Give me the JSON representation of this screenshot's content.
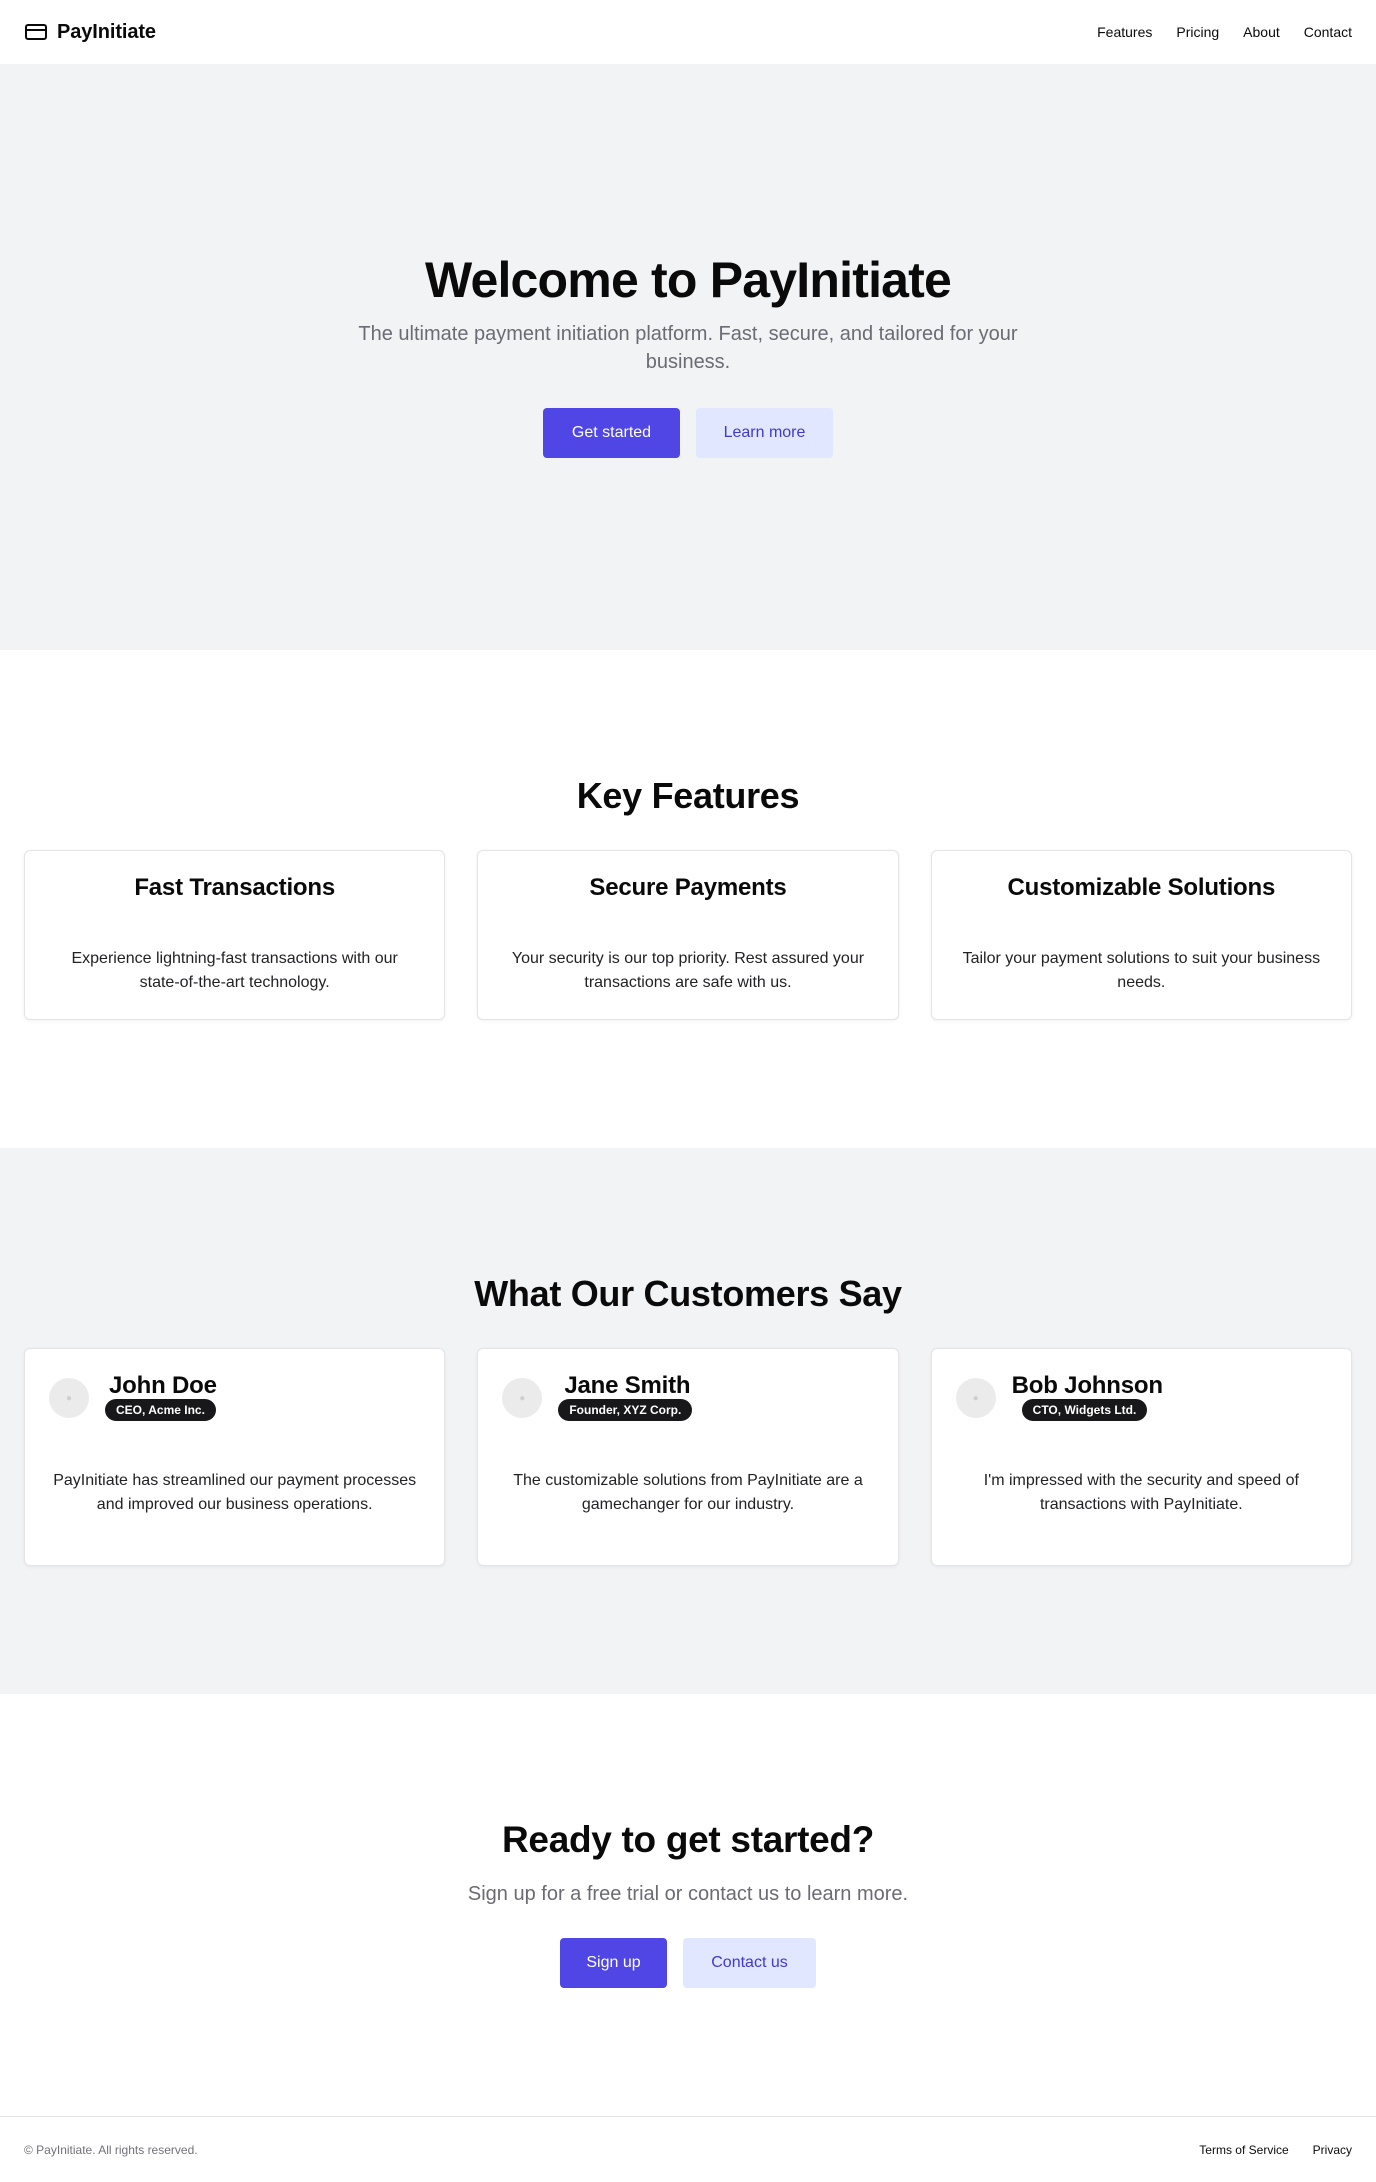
{
  "header": {
    "brand": "PayInitiate",
    "brand_icon": "credit-card-icon",
    "nav": [
      "Features",
      "Pricing",
      "About",
      "Contact"
    ]
  },
  "hero": {
    "title": "Welcome to PayInitiate",
    "subtitle": "The ultimate payment initiation platform. Fast, secure, and tailored for your business.",
    "primary_button": "Get started",
    "secondary_button": "Learn more"
  },
  "features": {
    "title": "Key Features",
    "items": [
      {
        "title": "Fast Transactions",
        "text": "Experience lightning-fast transactions with our state-of-the-art technology."
      },
      {
        "title": "Secure Payments",
        "text": "Your security is our top priority. Rest assured your transactions are safe with us."
      },
      {
        "title": "Customizable Solutions",
        "text": "Tailor your payment solutions to suit your business needs."
      }
    ]
  },
  "testimonials": {
    "title": "What Our Customers Say",
    "items": [
      {
        "name": "John Doe",
        "role": "CEO, Acme Inc.",
        "quote": "PayInitiate has streamlined our payment processes and improved our business operations."
      },
      {
        "name": "Jane Smith",
        "role": "Founder, XYZ Corp.",
        "quote": "The customizable solutions from PayInitiate are a gamechanger for our industry."
      },
      {
        "name": "Bob Johnson",
        "role": "CTO, Widgets Ltd.",
        "quote": "I'm impressed with the security and speed of transactions with PayInitiate."
      }
    ]
  },
  "cta": {
    "title": "Ready to get started?",
    "subtitle": "Sign up for a free trial or contact us to learn more.",
    "primary_button": "Sign up",
    "secondary_button": "Contact us"
  },
  "footer": {
    "copyright": "© PayInitiate. All rights reserved.",
    "links": [
      "Terms of Service",
      "Privacy"
    ]
  },
  "colors": {
    "accent": "#4f46e5",
    "accent_soft": "#e0e7ff",
    "section_bg": "#f2f3f5",
    "badge_bg": "#18181b"
  }
}
